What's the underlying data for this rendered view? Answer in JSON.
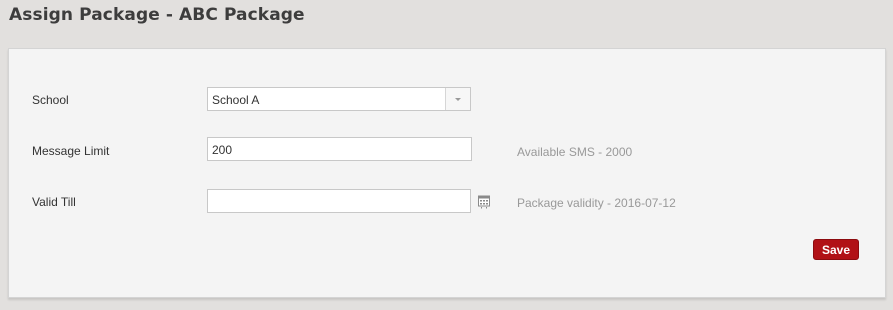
{
  "page": {
    "title": "Assign Package - ABC Package"
  },
  "form": {
    "school": {
      "label": "School",
      "selected": "School A"
    },
    "message_limit": {
      "label": "Message Limit",
      "value": "200",
      "help": "Available SMS - 2000"
    },
    "valid_till": {
      "label": "Valid Till",
      "value": "",
      "help": "Package validity - 2016-07-12"
    },
    "save_label": "Save"
  },
  "colors": {
    "background": "#e2e0de",
    "panel": "#f4f4f4",
    "save_button": "#b11116",
    "help_text": "#999999"
  },
  "icons": {
    "select_arrow": "chevron-down-icon",
    "calendar": "calendar-icon"
  }
}
